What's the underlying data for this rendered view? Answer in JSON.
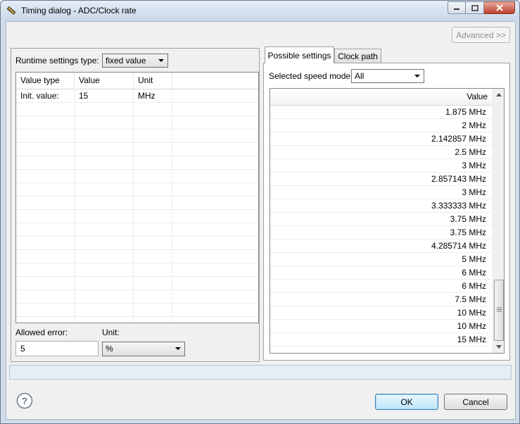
{
  "window": {
    "title": "Timing dialog - ADC/Clock rate"
  },
  "toolbar": {
    "advanced_label": "Advanced >>"
  },
  "left": {
    "runtime_label": "Runtime settings type:",
    "runtime_value": "fixed value",
    "table": {
      "headers": [
        "Value type",
        "Value",
        "Unit"
      ],
      "rows": [
        [
          "Init. value:",
          "15",
          "MHz"
        ]
      ]
    },
    "allowed_error_label": "Allowed error:",
    "allowed_error_value": "5",
    "unit_label": "Unit:",
    "unit_value": "%"
  },
  "right": {
    "tabs": [
      {
        "label": "Possible settings",
        "active": true
      },
      {
        "label": "Clock path",
        "active": false
      }
    ],
    "speed_mode_label": "Selected speed mode",
    "speed_mode_value": "All",
    "list_header": "Value",
    "values": [
      "1.875 MHz",
      "2 MHz",
      "2.142857 MHz",
      "2.5 MHz",
      "3 MHz",
      "2.857143 MHz",
      "3 MHz",
      "3.333333 MHz",
      "3.75 MHz",
      "3.75 MHz",
      "4.285714 MHz",
      "5 MHz",
      "6 MHz",
      "6 MHz",
      "7.5 MHz",
      "10 MHz",
      "10 MHz",
      "15 MHz"
    ]
  },
  "footer": {
    "ok_label": "OK",
    "cancel_label": "Cancel"
  },
  "colors": {
    "accent": "#3c7fb1",
    "frame": "#cfdbe9"
  }
}
